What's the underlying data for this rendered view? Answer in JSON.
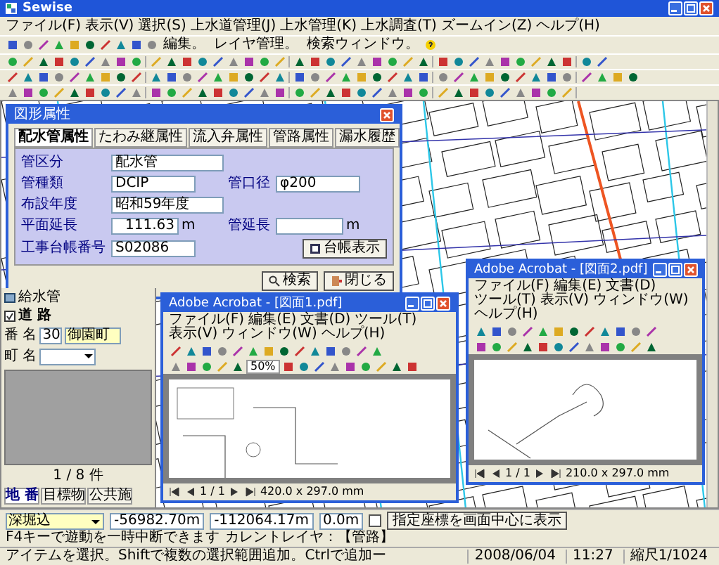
{
  "window": {
    "title": "Sewise"
  },
  "menu": [
    "ファイル(F)",
    "表示(V)",
    "選択(S)",
    "上水道管理(J)",
    "上水管理(K)",
    "上水調査(T)",
    "ズームイン(Z)",
    "ヘルプ(H)"
  ],
  "toolbar_buttons": [
    "編集。",
    "レイヤ管理。",
    "検索ウィンドウ。"
  ],
  "attribute_dialog": {
    "title": "図形属性",
    "tabs": [
      {
        "label": "配水管属性",
        "selected": true
      },
      {
        "label": "たわみ継属性",
        "selected": false
      },
      {
        "label": "流入弁属性",
        "selected": false
      },
      {
        "label": "管路属性",
        "selected": false
      },
      {
        "label": "漏水履歴",
        "selected": false
      }
    ],
    "fields": [
      {
        "label": "管区分",
        "value": "配水管"
      },
      {
        "label": "管種類",
        "value": "DCIP"
      },
      {
        "label": "管口径",
        "value": "φ200"
      },
      {
        "label": "布設年度",
        "value": "昭和59年度"
      },
      {
        "label": "平面延長",
        "value": "111.63",
        "unit": "m"
      },
      {
        "label": "管延長",
        "unit": "m"
      },
      {
        "label": "工事台帳番号",
        "value": "S02086"
      }
    ],
    "ledger_button": "台帳表示",
    "buttons": [
      "検索",
      "閉じる"
    ]
  },
  "search_panel": {
    "tree_item": "給水管",
    "section": "道 路",
    "fields": [
      {
        "kind": "text",
        "label": "番 名",
        "code": "30",
        "value": "御園町"
      },
      {
        "kind": "dropdown",
        "label": "町 名"
      }
    ],
    "count": "1 / 8 件",
    "tabs": [
      {
        "label": "地 番",
        "selected": true
      },
      {
        "label": "目標物",
        "selected": false
      },
      {
        "label": "公共施",
        "selected": false
      }
    ]
  },
  "pdf_windows": [
    {
      "title": "Adobe Acrobat - [図面1.pdf]",
      "menu": [
        "ファイル(F)",
        "編集(E)",
        "文書(D)",
        "ツール(T)",
        "表示(V)",
        "ウィンドウ(W)",
        "ヘルプ(H)"
      ],
      "zoom": "50%",
      "page": "1 / 1",
      "page_size": "420.0 x 297.0 mm"
    },
    {
      "title": "Adobe Acrobat - [図面2.pdf]",
      "menu": [
        "ファイル(F)",
        "編集(E)",
        "文書(D)",
        "ツール(T)",
        "表示(V)",
        "ウィンドウ(W)",
        "ヘルプ(H)"
      ],
      "page": "1 / 1",
      "page_size": "210.0 x 297.0 mm"
    }
  ],
  "status_bar": {
    "layer": "深堀込",
    "x": "-56982.70m",
    "y": "-112064.17m",
    "z": "0.0m",
    "center_checked": false,
    "center_button": "指定座標を画面中心に表示",
    "hint": "F4キーで遊動を一時中断できます",
    "current_layer": "カレントレイヤ：【管路】",
    "message": "アイテムを選択。Shiftで複数の選択範囲追加。Ctrlで追加ー",
    "date": "2008/06/04",
    "time": "11:27",
    "scale": "縮尺1/1024"
  }
}
